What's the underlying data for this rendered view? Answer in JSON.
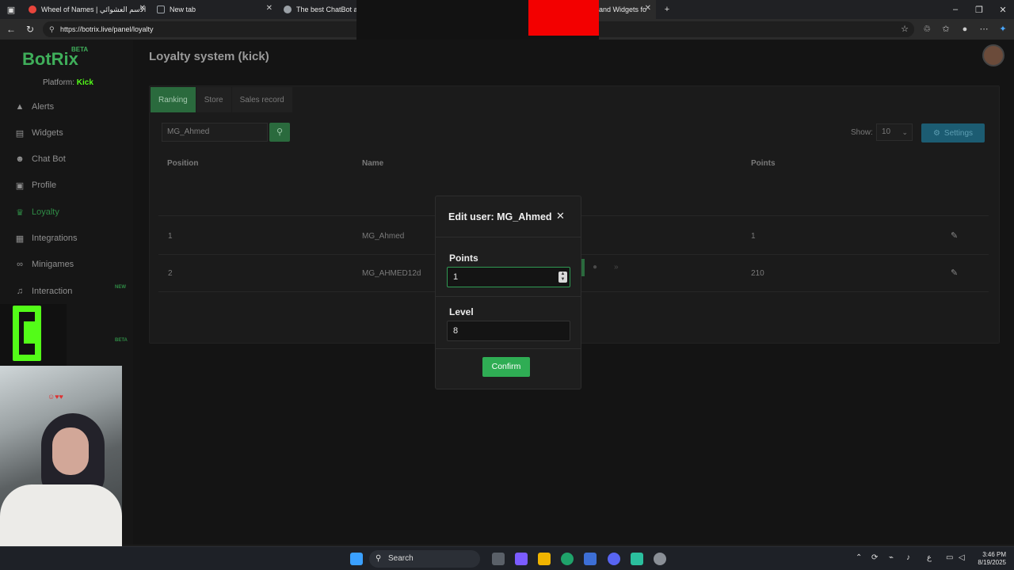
{
  "browser": {
    "tabs": [
      {
        "label": "Wheel of Names | الاسم العشوائي",
        "favicon_color": "#e8453c"
      },
      {
        "label": "New tab",
        "favicon_color": "#9aa0a6"
      },
      {
        "label": "The best ChatBot and",
        "favicon_color": "#9aa0a6"
      },
      {
        "label": "and Widgets fo",
        "favicon_color": "#9aa0a6"
      }
    ],
    "new_tab": "+",
    "url": "https://botrix.live/panel/loyalty",
    "controls": {
      "minimize": "–",
      "maximize": "❐",
      "close": "✕"
    }
  },
  "sidebar": {
    "logo": "BotRix",
    "logo_badge": "BETA",
    "platform_label": "Platform:",
    "platform_value": "Kick",
    "items": [
      {
        "label": "Alerts",
        "icon": "warning-icon"
      },
      {
        "label": "Widgets",
        "icon": "widgets-icon"
      },
      {
        "label": "Chat Bot",
        "icon": "robot-icon"
      },
      {
        "label": "Profile",
        "icon": "profile-card-icon"
      },
      {
        "label": "Loyalty",
        "icon": "trophy-icon",
        "active": true
      },
      {
        "label": "Integrations",
        "icon": "puzzle-icon"
      },
      {
        "label": "Minigames",
        "icon": "gamepad-icon"
      },
      {
        "label": "Interaction",
        "icon": "music-note-icon",
        "badge": "NEW"
      }
    ],
    "partial_badge": "BETA"
  },
  "main": {
    "title": "Loyalty system (kick)",
    "tabs": [
      "Ranking",
      "Store",
      "Sales record"
    ],
    "active_tab": "Ranking",
    "search_value": "MG_Ahmed",
    "show_label": "Show:",
    "show_value": "10",
    "settings_label": "Settings",
    "table": {
      "headers": [
        "Position",
        "Name",
        "Points"
      ],
      "rows": [
        {
          "position": "1",
          "name": "MG_Ahmed",
          "points": "1"
        },
        {
          "position": "2",
          "name": "MG_AHMED12d",
          "points": "210"
        }
      ]
    },
    "pager_next": "»"
  },
  "modal": {
    "title": "Edit user: MG_Ahmed",
    "close": "✕",
    "points_label": "Points",
    "points_value": "1",
    "level_label": "Level",
    "level_value": "8",
    "confirm_label": "Confirm"
  },
  "taskbar": {
    "search_label": "Search",
    "lang": "ع",
    "time": "3:46 PM",
    "date": "8/19/2025"
  },
  "colors": {
    "accent_green": "#2fad54",
    "kick_green": "#53fc18",
    "settings_blue": "#1c5c72"
  }
}
